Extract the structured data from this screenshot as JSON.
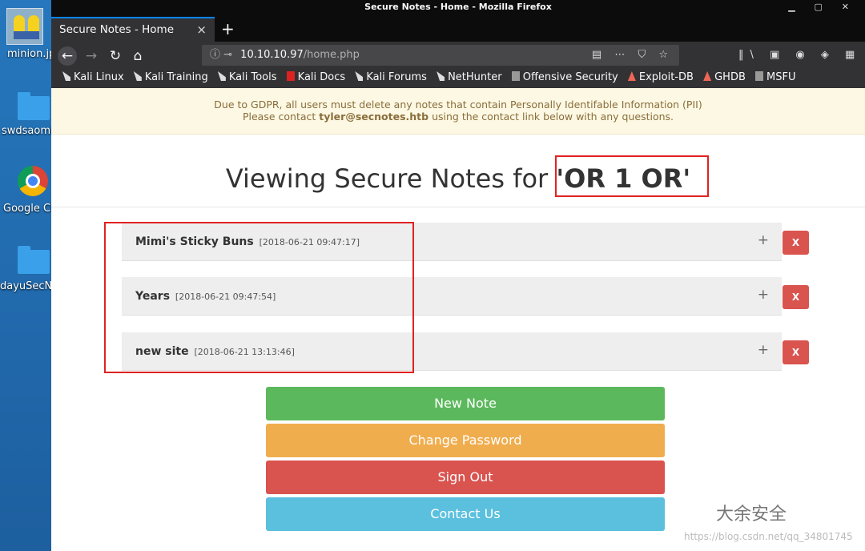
{
  "desktop": {
    "icons": [
      {
        "label": "minion.jp"
      },
      {
        "label": "swdsaomi"
      },
      {
        "label": "Google Ch"
      },
      {
        "label": "dayuSecN"
      }
    ]
  },
  "window": {
    "title": "Secure Notes - Home - Mozilla Firefox",
    "tab_title": "Secure Notes - Home",
    "tab_close": "×",
    "new_tab": "+",
    "url_host": "10.10.10.97",
    "url_path": "/home.php",
    "url_prefix": "ⓘ ⊸",
    "url_icons": "▤ ⋯ ⛉ ☆",
    "tool_icons": "‖\\ ▣ ◉ ◈ ▦",
    "win_controls": "▁ ▢ ✕"
  },
  "nav": {
    "back": "←",
    "forward": "→",
    "reload": "↻",
    "home": "⌂"
  },
  "bookmarks": [
    {
      "label": "Kali Linux",
      "icon": "kali-dragon-icon"
    },
    {
      "label": "Kali Training",
      "icon": "kali-dragon-icon"
    },
    {
      "label": "Kali Tools",
      "icon": "kali-dragon-icon"
    },
    {
      "label": "Kali Docs",
      "icon": "kali-docs-icon"
    },
    {
      "label": "Kali Forums",
      "icon": "kali-dragon-icon"
    },
    {
      "label": "NetHunter",
      "icon": "nethunter-icon"
    },
    {
      "label": "Offensive Security",
      "icon": "offsec-icon"
    },
    {
      "label": "Exploit-DB",
      "icon": "exploitdb-icon"
    },
    {
      "label": "GHDB",
      "icon": "ghdb-icon"
    },
    {
      "label": "MSFU",
      "icon": "msfu-icon"
    }
  ],
  "gdpr": {
    "line1": "Due to GDPR, all users must delete any notes that contain Personally Identifable Information (PII)",
    "line2_pre": "Please contact ",
    "email": "tyler@secnotes.htb",
    "line2_post": " using the contact link below with any questions."
  },
  "heading": {
    "prefix": "Viewing Secure Notes for ",
    "username": "'OR 1 OR'"
  },
  "notes": [
    {
      "title": "Mimi's Sticky Buns",
      "date": "[2018-06-21 09:47:17]",
      "expand": "+",
      "delete": "X"
    },
    {
      "title": "Years",
      "date": "[2018-06-21 09:47:54]",
      "expand": "+",
      "delete": "X"
    },
    {
      "title": "new site",
      "date": "[2018-06-21 13:13:46]",
      "expand": "+",
      "delete": "X"
    }
  ],
  "buttons": {
    "new_note": "New Note",
    "change_password": "Change Password",
    "sign_out": "Sign Out",
    "contact_us": "Contact Us"
  },
  "watermark": {
    "brand": "大余安全",
    "url": "https://blog.csdn.net/qq_34801745"
  },
  "colors": {
    "annotation_red": "#e02222",
    "btn_green": "#5cb85c",
    "btn_orange": "#f0ad4e",
    "btn_red": "#d9534f",
    "btn_blue": "#5bc0de"
  }
}
